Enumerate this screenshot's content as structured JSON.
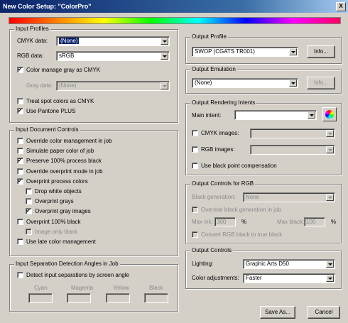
{
  "window": {
    "title": "New Color Setup: \"ColorPro\"",
    "close": "X"
  },
  "input_profiles": {
    "legend": "Input Profiles",
    "cmyk_label": "CMYK data:",
    "cmyk_value": "(None)",
    "rgb_label": "RGB data:",
    "rgb_value": "sRGB",
    "color_manage_gray": "Color manage gray as CMYK",
    "gray_label": "Gray data:",
    "gray_value": "(None)",
    "treat_spot": "Treat spot colors as CMYK",
    "use_pantone": "Use Pantone PLUS"
  },
  "input_document_controls": {
    "legend": "Input Document Controls",
    "items": [
      {
        "label": "Override color management in job",
        "checked": false,
        "disabled": false,
        "indent": 0
      },
      {
        "label": "Simulate paper color of job",
        "checked": false,
        "disabled": false,
        "indent": 0
      },
      {
        "label": "Preserve 100% process black",
        "checked": true,
        "disabled": false,
        "indent": 0
      },
      {
        "label": "Override overprint mode in job",
        "checked": false,
        "disabled": false,
        "indent": 0
      },
      {
        "label": "Overprint process colors",
        "checked": true,
        "disabled": false,
        "indent": 0
      },
      {
        "label": "Drop white objects",
        "checked": false,
        "disabled": false,
        "indent": 1
      },
      {
        "label": "Overprint grays",
        "checked": false,
        "disabled": false,
        "indent": 1
      },
      {
        "label": "Overprint gray images",
        "checked": true,
        "disabled": false,
        "indent": 1
      },
      {
        "label": "Overprint 100% black",
        "checked": false,
        "disabled": false,
        "indent": 0
      },
      {
        "label": "Image only black",
        "checked": false,
        "disabled": true,
        "indent": 1
      },
      {
        "label": "Use late color management",
        "checked": false,
        "disabled": false,
        "indent": 0
      }
    ]
  },
  "input_separation": {
    "legend": "Input Separation Detection Angles in Job",
    "detect": "Detect input separations by screen angle",
    "cols": [
      "Cyan",
      "Magenta",
      "Yellow",
      "Black"
    ]
  },
  "output_profile": {
    "legend": "Output Profile",
    "value": "SWOP (CGATS TR001)",
    "info": "Info..."
  },
  "output_emulation": {
    "legend": "Output Emulation",
    "value": "(None)",
    "info": "Info..."
  },
  "output_rendering": {
    "legend": "Output Rendering Intents",
    "main_label": "Main intent:",
    "main_value": "",
    "cmyk_images": "CMYK images:",
    "rgb_images": "RGB images:",
    "black_point": "Use black point compensation"
  },
  "output_rgb": {
    "legend": "Output Controls for RGB",
    "black_gen_label": "Black generation:",
    "black_gen_value": "None",
    "override_black": "Override black generation in job",
    "max_ink_label": "Max ink:",
    "max_ink_value": "300",
    "pct1": "%",
    "max_black_label": "Max black:",
    "max_black_value": "100",
    "pct2": "%",
    "convert": "Convert RGB black to true black"
  },
  "output_controls": {
    "legend": "Output Controls",
    "lighting_label": "Lighting:",
    "lighting_value": "Graphic Arts D50",
    "color_adj_label": "Color adjustments:",
    "color_adj_value": "Faster"
  },
  "buttons": {
    "save_as": "Save As...",
    "cancel": "Cancel"
  }
}
